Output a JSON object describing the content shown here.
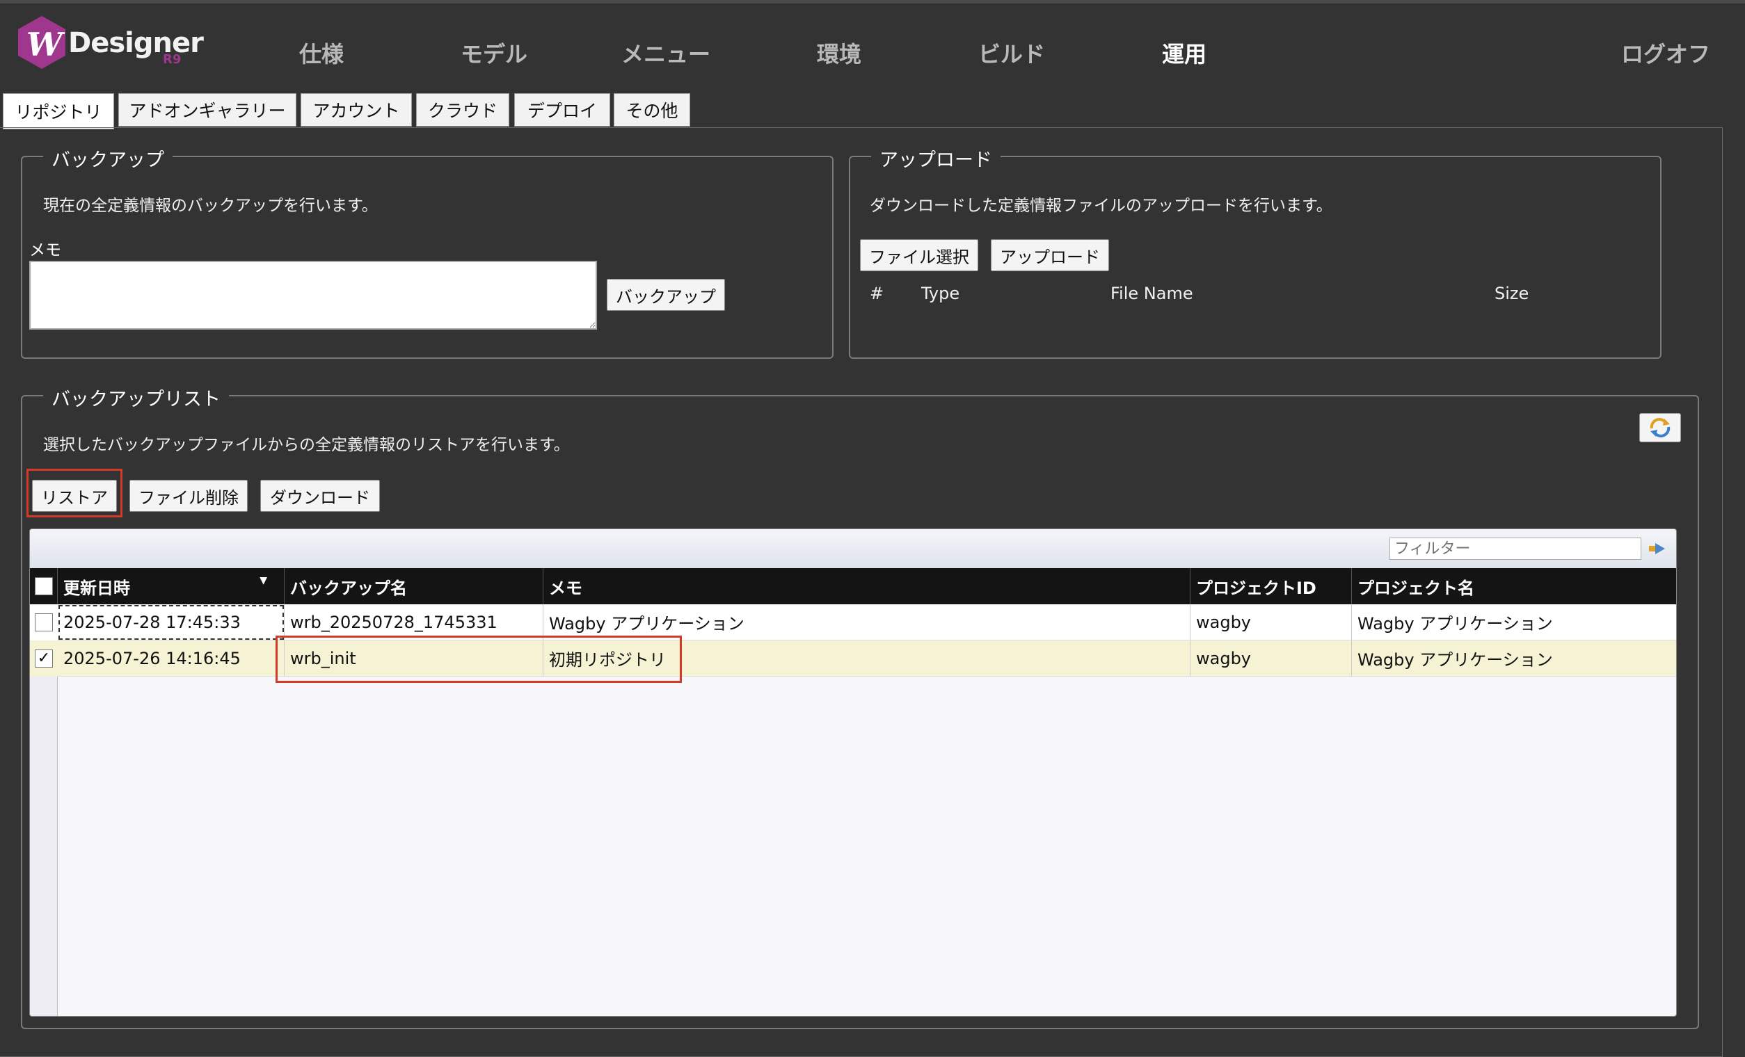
{
  "brand": {
    "w_letter": "W",
    "name": "Designer",
    "version": "R9",
    "accent_color": "#a0378f"
  },
  "nav": {
    "items": [
      "仕様",
      "モデル",
      "メニュー",
      "環境",
      "ビルド",
      "運用"
    ],
    "active": "運用",
    "logoff": "ログオフ"
  },
  "tabs": [
    "リポジトリ",
    "アドオンギャラリー",
    "アカウント",
    "クラウド",
    "デプロイ",
    "その他"
  ],
  "backup": {
    "legend": "バックアップ",
    "description": "現在の全定義情報のバックアップを行います。",
    "memo_label": "メモ",
    "memo_value": "",
    "button": "バックアップ"
  },
  "upload": {
    "legend": "アップロード",
    "description": "ダウンロードした定義情報ファイルのアップロードを行います。",
    "select_button": "ファイル選択",
    "upload_button": "アップロード",
    "columns": [
      "#",
      "Type",
      "File Name",
      "Size"
    ]
  },
  "backup_list": {
    "legend": "バックアップリスト",
    "description": "選択したバックアップファイルからの全定義情報のリストアを行います。",
    "restore_button": "リストア",
    "delete_button": "ファイル削除",
    "download_button": "ダウンロード",
    "refresh_icon": "refresh-icon",
    "filter_placeholder": "フィルター",
    "columns": [
      "更新日時",
      "バックアップ名",
      "メモ",
      "プロジェクトID",
      "プロジェクト名"
    ],
    "rows": [
      {
        "checked": false,
        "date": "2025-07-28 17:45:33",
        "name": "wrb_20250728_1745331",
        "memo": "Wagby アプリケーション",
        "project_id": "wagby",
        "project_name": "Wagby アプリケーション"
      },
      {
        "checked": true,
        "date": "2025-07-26 14:16:45",
        "name": "wrb_init",
        "memo": "初期リポジトリ",
        "project_id": "wagby",
        "project_name": "Wagby アプリケーション"
      }
    ],
    "highlight_color": "#d23a2a",
    "selected_row_color": "#f6f2d4"
  }
}
